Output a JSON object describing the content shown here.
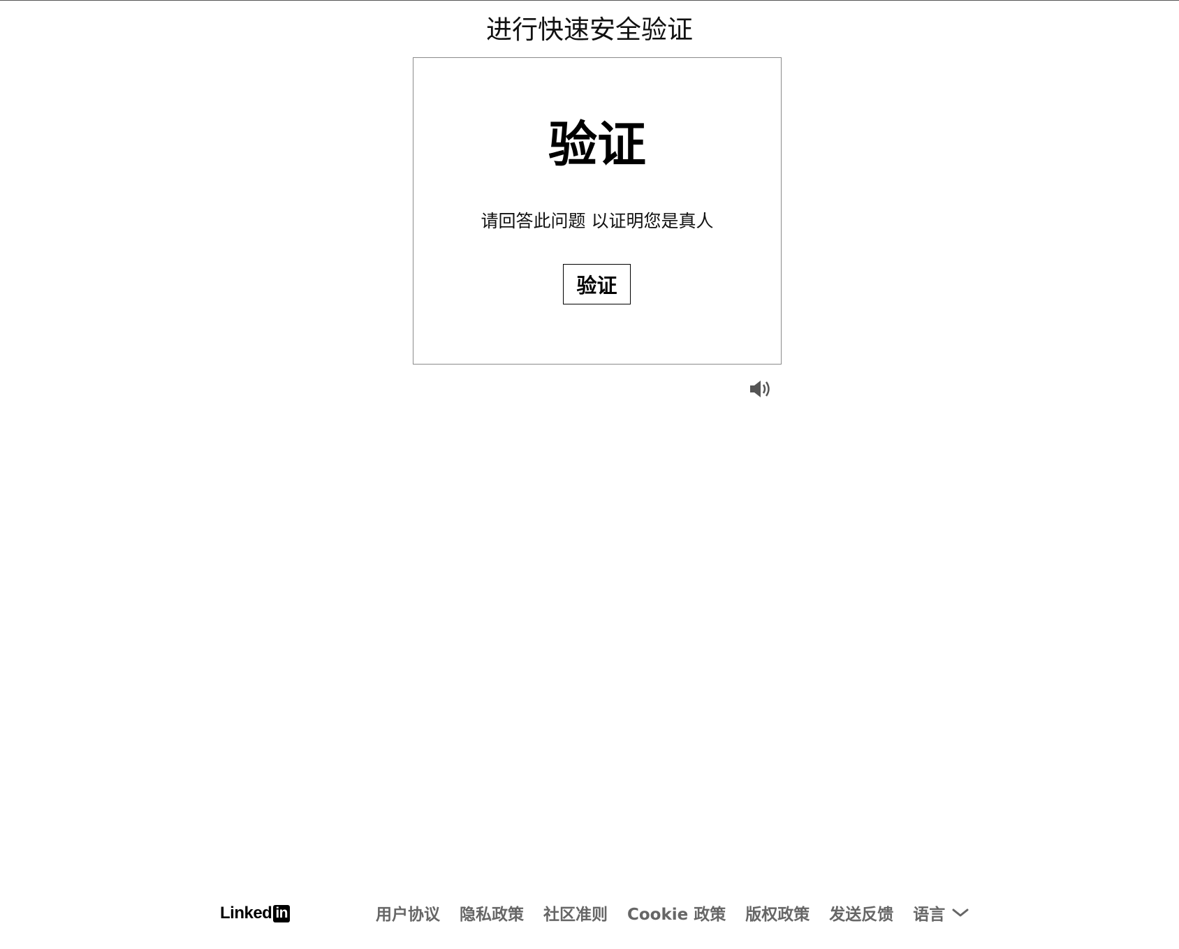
{
  "header": {
    "title": "进行快速安全验证"
  },
  "challenge": {
    "heading": "验证",
    "instruction": "请回答此问题 以证明您是真人",
    "verify_button_label": "验证",
    "audio_icon": "speaker-icon"
  },
  "footer": {
    "logo_text": "Linked",
    "logo_box_text": "in",
    "links": [
      {
        "label": "用户协议"
      },
      {
        "label": "隐私政策"
      },
      {
        "label": "社区准则"
      },
      {
        "label": "Cookie 政策"
      },
      {
        "label": "版权政策"
      },
      {
        "label": "发送反馈"
      }
    ],
    "language_label": "语言",
    "language_icon": "chevron-down-icon"
  },
  "colors": {
    "footer_link": "#666666",
    "frame_border": "#8a8a8a",
    "text": "#000000"
  }
}
